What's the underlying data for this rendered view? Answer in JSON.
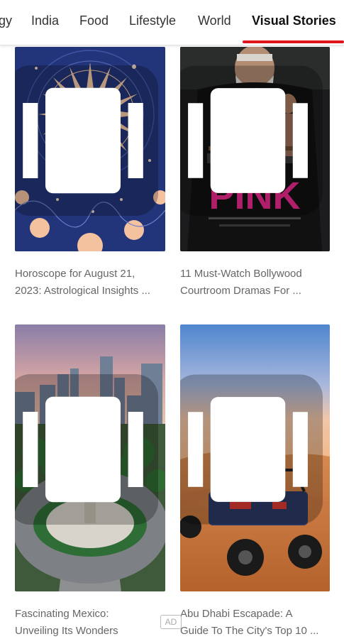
{
  "nav": {
    "tabs": [
      {
        "label": "gy"
      },
      {
        "label": "India"
      },
      {
        "label": "Food"
      },
      {
        "label": "Lifestyle"
      },
      {
        "label": "World"
      },
      {
        "label": "Visual Stories",
        "active": true
      }
    ],
    "accent_color": "#e0161e"
  },
  "stories": [
    {
      "caption": "Horoscope for August 21,\n2023: Astrological Insights ...",
      "image": "sun-zodiac-illustration"
    },
    {
      "caption": "11 Must-Watch Bollywood\nCourtroom Dramas For ...",
      "image": "pink-movie-poster",
      "poster_text": "PINK"
    },
    {
      "caption": "Fascinating Mexico:\nUnveiling Its Wonders",
      "image": "mexico-city-aerial"
    },
    {
      "caption": "Abu Dhabi Escapade: A\nGuide To The City's Top 10 ...",
      "image": "desert-buggy"
    }
  ],
  "ad_label": "AD",
  "icons": {
    "story_badge": "stories-icon"
  }
}
